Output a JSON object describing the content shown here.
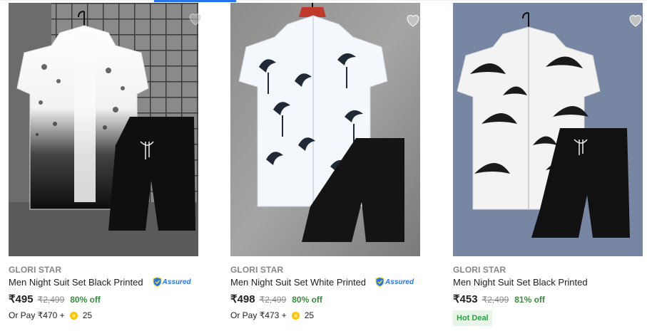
{
  "products": [
    {
      "brand": "GLORI STAR",
      "title": "Men Night Suit Set Black Printed",
      "assured": "Assured",
      "price": "₹495",
      "mrp": "₹2,499",
      "discount": "80% off",
      "pay_prefix": "Or Pay ₹470 +",
      "coins": "25",
      "image_icon": "shirt-shorts-ombre-print",
      "wishlist_icon": "heart-icon"
    },
    {
      "brand": "GLORI STAR",
      "title": "Men Night Suit Set White Printed",
      "assured": "Assured",
      "price": "₹498",
      "mrp": "₹2,499",
      "discount": "80% off",
      "pay_prefix": "Or Pay ₹473 +",
      "coins": "25",
      "image_icon": "shirt-shorts-palm-print",
      "wishlist_icon": "heart-icon"
    },
    {
      "brand": "GLORI STAR",
      "title": "Men Night Suit Set Black Printed",
      "price": "₹453",
      "mrp": "₹2,499",
      "discount": "81% off",
      "badge": "Hot Deal",
      "image_icon": "shirt-shorts-leaf-print",
      "wishlist_icon": "heart-icon"
    }
  ],
  "colors": {
    "accent": "#2874f0",
    "discount": "#388e3c",
    "muted": "#878787",
    "hot_deal_bg": "#e8f5e9",
    "coin": "#ffc200"
  }
}
